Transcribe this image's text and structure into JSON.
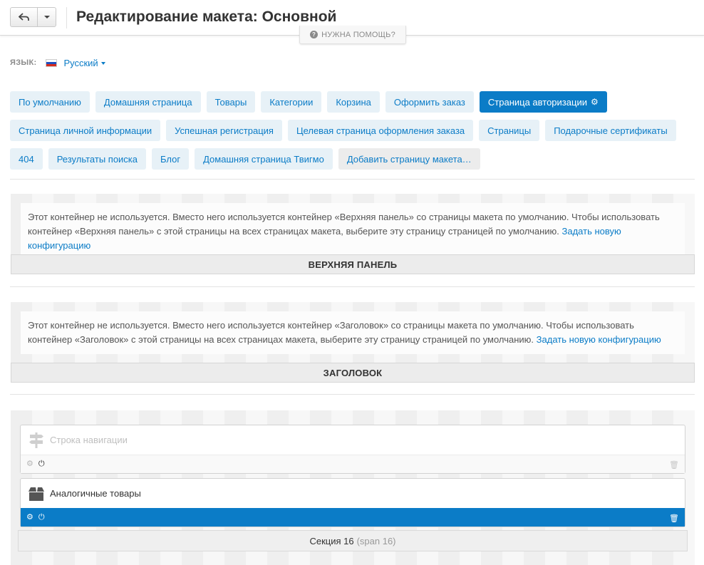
{
  "header": {
    "title": "Редактирование макета: Основной",
    "help_label": "НУЖНА ПОМОЩЬ?"
  },
  "language": {
    "label": "ЯЗЫК:",
    "current": "Русский"
  },
  "pages": [
    {
      "label": "По умолчанию",
      "active": false
    },
    {
      "label": "Домашняя страница",
      "active": false
    },
    {
      "label": "Товары",
      "active": false
    },
    {
      "label": "Категории",
      "active": false
    },
    {
      "label": "Корзина",
      "active": false
    },
    {
      "label": "Оформить заказ",
      "active": false
    },
    {
      "label": "Страница авторизации",
      "active": true
    },
    {
      "label": "Страница личной информации",
      "active": false
    },
    {
      "label": "Успешная регистрация",
      "active": false
    },
    {
      "label": "Целевая страница оформления заказа",
      "active": false
    },
    {
      "label": "Страницы",
      "active": false
    },
    {
      "label": "Подарочные сертификаты",
      "active": false
    },
    {
      "label": "404",
      "active": false
    },
    {
      "label": "Результаты поиска",
      "active": false
    },
    {
      "label": "Блог",
      "active": false
    },
    {
      "label": "Домашняя страница Твигмо",
      "active": false
    }
  ],
  "add_page_label": "Добавить страницу макета…",
  "containers": {
    "top_panel": {
      "note": "Этот контейнер не используется. Вместо него используется контейнер «Верхняя панель» со страницы макета по умолчанию. Чтобы использовать контейнер «Верхняя панель» с этой страницы на всех страницах макета, выберите эту страницу страницей по умолчанию.",
      "link": "Задать новую конфигурацию",
      "title": "ВЕРХНЯЯ ПАНЕЛЬ"
    },
    "header": {
      "note": "Этот контейнер не используется. Вместо него используется контейнер «Заголовок» со страницы макета по умолчанию. Чтобы использовать контейнер «Заголовок» с этой страницы на всех страницах макета, выберите эту страницу страницей по умолчанию.",
      "link": "Задать новую конфигурацию",
      "title": "ЗАГОЛОВОК"
    },
    "content": {
      "blocks": [
        {
          "name": "Строка навигации",
          "enabled": false,
          "icon": "signpost-icon"
        },
        {
          "name": "Аналогичные товары",
          "enabled": true,
          "icon": "box-icon"
        }
      ],
      "grid_label": "Секция 16",
      "grid_span": "(span 16)"
    }
  },
  "colors": {
    "accent": "#0b7cc7",
    "tab_bg": "#e7f1f7",
    "flag": [
      "#ffffff",
      "#1f4fbf",
      "#d52b1e"
    ]
  }
}
